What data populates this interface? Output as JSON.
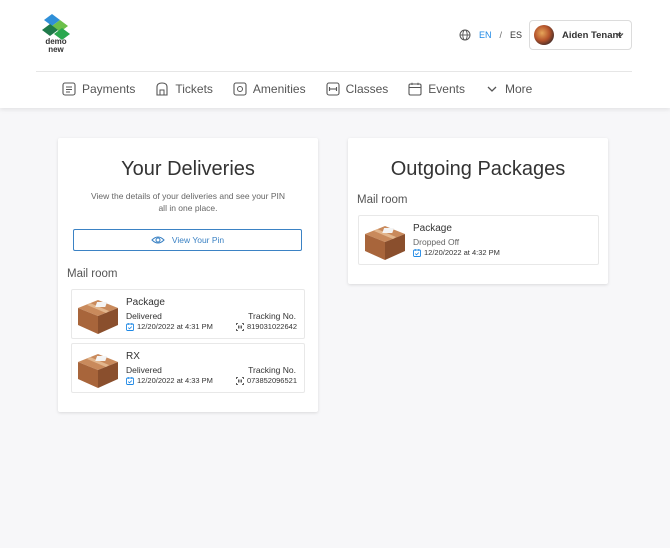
{
  "header": {
    "logo_text_line1": "demo",
    "logo_text_line2": "new",
    "lang": {
      "en": "EN",
      "sep": "/",
      "es": "ES"
    },
    "user": {
      "name": "Aiden Tenant"
    }
  },
  "nav": [
    {
      "label": "Payments",
      "icon": "receipt-icon"
    },
    {
      "label": "Tickets",
      "icon": "ticket-icon"
    },
    {
      "label": "Amenities",
      "icon": "amenities-icon"
    },
    {
      "label": "Classes",
      "icon": "classes-icon"
    },
    {
      "label": "Events",
      "icon": "calendar-icon"
    },
    {
      "label": "More",
      "icon": "chevron-down-icon"
    }
  ],
  "deliveries": {
    "title": "Your Deliveries",
    "description": "View the details of your deliveries and see your PIN all in one place.",
    "pin_button": "View Your Pin",
    "section": "Mail room",
    "items": [
      {
        "name": "Package",
        "status": "Delivered",
        "date": "12/20/2022 at 4:31 PM",
        "tracking_label": "Tracking No.",
        "tracking_number": "819031022642"
      },
      {
        "name": "RX",
        "status": "Delivered",
        "date": "12/20/2022 at 4:33 PM",
        "tracking_label": "Tracking No.",
        "tracking_number": "073852096521"
      }
    ]
  },
  "outgoing": {
    "title": "Outgoing Packages",
    "section": "Mail room",
    "items": [
      {
        "name": "Package",
        "status": "Dropped Off",
        "date": "12/20/2022 at 4:32 PM"
      }
    ]
  },
  "colors": {
    "accent": "#1e88e5",
    "button_border": "#3b82c4",
    "background": "#f7f7f9"
  }
}
